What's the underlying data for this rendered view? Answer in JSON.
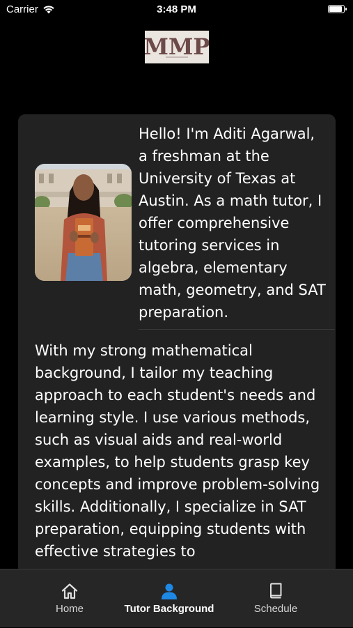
{
  "status_bar": {
    "carrier": "Carrier",
    "time": "3:48 PM",
    "battery_level": 0.95
  },
  "logo": {
    "text": "MMP"
  },
  "profile": {
    "intro": "Hello! I'm Aditi Agarwal, a freshman at the University of Texas at Austin. As a math tutor, I offer comprehensive tutoring services in algebra, elementary math, geometry, and SAT preparation.",
    "body": "With my strong mathematical background, I tailor my teaching approach to each student's needs and learning style. I use various methods, such as visual aids and real-world examples, to help students grasp key concepts and improve problem-solving skills. Additionally, I specialize in SAT preparation, equipping students with effective strategies to"
  },
  "tabs": [
    {
      "label": "Home",
      "icon": "home-icon",
      "active": false
    },
    {
      "label": "Tutor Background",
      "icon": "person-icon",
      "active": true
    },
    {
      "label": "Schedule",
      "icon": "book-icon",
      "active": false
    }
  ],
  "colors": {
    "active_tab": "#1e88e5",
    "card": "#222223",
    "background": "#000000"
  }
}
